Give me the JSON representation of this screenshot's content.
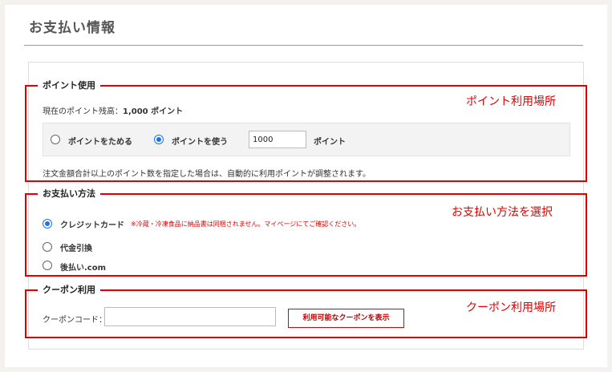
{
  "page": {
    "title": "お支払い情報"
  },
  "points": {
    "section_title": "ポイント使用",
    "annotation": "ポイント利用場所",
    "balance_label": "現在のポイント残高：",
    "balance_value": "1,000 ポイント",
    "option_save": "ポイントをためる",
    "option_use": "ポイントを使う",
    "selected": "use",
    "input_value": "1000",
    "unit": "ポイント",
    "note": "注文金額合計以上のポイント数を指定した場合は、自動的に利用ポイントが調整されます。"
  },
  "payment": {
    "section_title": "お支払い方法",
    "annotation": "お支払い方法を選択",
    "options": [
      {
        "label": "クレジットカード",
        "selected": true
      },
      {
        "label": "代金引換",
        "selected": false
      },
      {
        "label": "後払い.com",
        "selected": false
      }
    ],
    "credit_note": "※冷蔵・冷凍食品に納品書は同梱されません。マイページにてご確認ください。"
  },
  "coupon": {
    "section_title": "クーポン利用",
    "annotation": "クーポン利用場所",
    "code_label": "クーポンコード：",
    "input_value": "",
    "button_label": "利用可能なクーポンを表示"
  },
  "colors": {
    "highlight": "#e00000",
    "radio_selected": "#1a73e8",
    "background": "#f3f2ef"
  }
}
